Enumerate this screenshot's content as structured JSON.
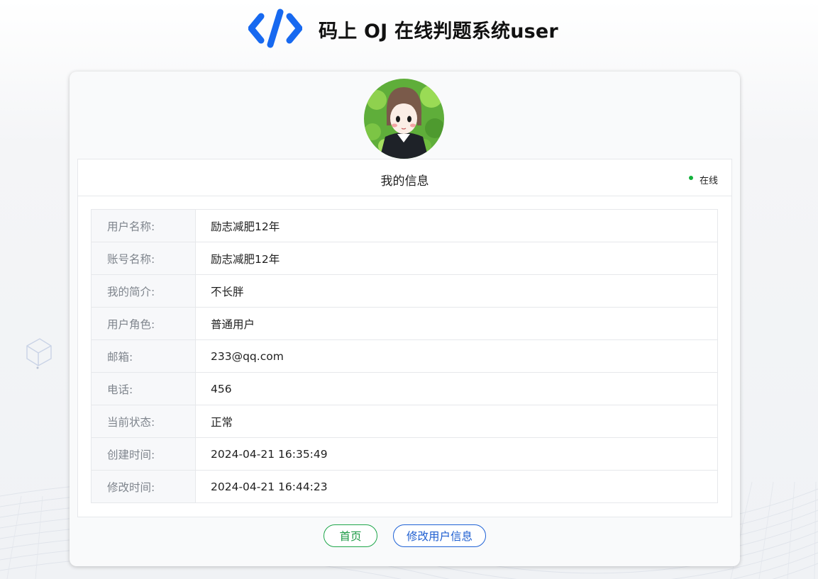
{
  "header": {
    "logo_icon": "code-brackets-icon",
    "title": "码上 OJ 在线判题系统user"
  },
  "profile": {
    "avatar_icon": "user-avatar-illustration",
    "panel_title": "我的信息",
    "status_label": "在线",
    "status_color": "#12b13b",
    "fields": [
      {
        "label": "用户名称:",
        "value": "励志减肥12年"
      },
      {
        "label": "账号名称:",
        "value": "励志减肥12年"
      },
      {
        "label": "我的简介:",
        "value": "不长胖"
      },
      {
        "label": "用户角色:",
        "value": "普通用户"
      },
      {
        "label": "邮箱:",
        "value": "233@qq.com"
      },
      {
        "label": "电话:",
        "value": "456"
      },
      {
        "label": "当前状态:",
        "value": "正常"
      },
      {
        "label": "创建时间:",
        "value": "2024-04-21 16:35:49"
      },
      {
        "label": "修改时间:",
        "value": "2024-04-21 16:44:23"
      }
    ]
  },
  "actions": {
    "home_label": "首页",
    "edit_label": "修改用户信息"
  },
  "colors": {
    "brand_blue": "#1769f0",
    "home_green": "#1fa64a",
    "edit_blue": "#1f62d6"
  }
}
